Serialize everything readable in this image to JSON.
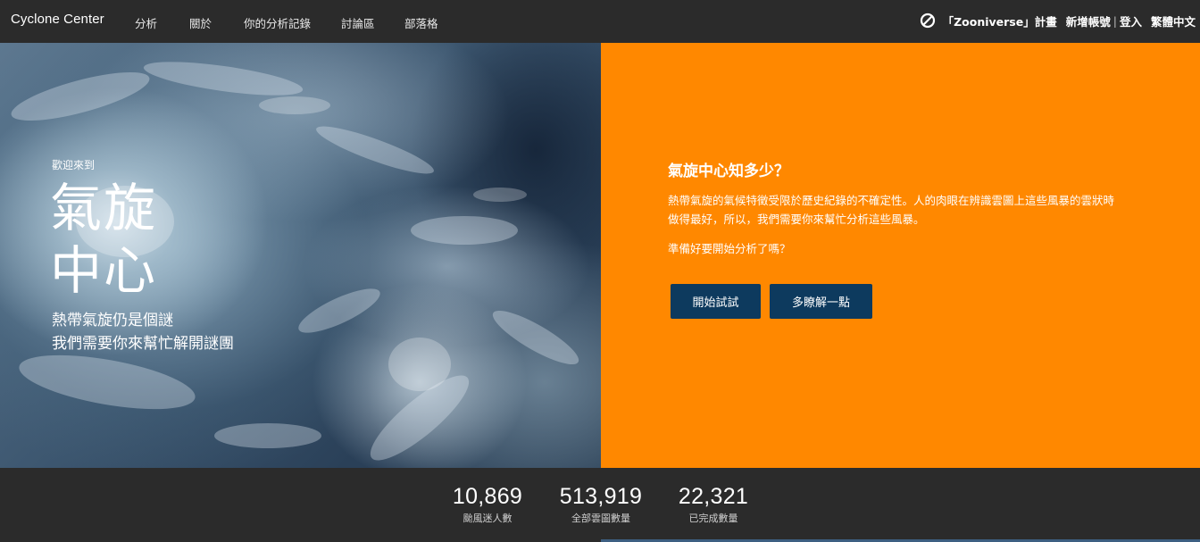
{
  "header": {
    "brand": "Cyclone Center",
    "nav": [
      "分析",
      "關於",
      "你的分析記錄",
      "討論區",
      "部落格"
    ],
    "zooniverse_label": "「Zooniverse」計畫",
    "signup": "新增帳號",
    "separator": "|",
    "login": "登入",
    "language": "繁體中文"
  },
  "hero": {
    "welcome": "歡迎來到",
    "title_line1": "氣旋",
    "title_line2": "中心",
    "tagline_line1": "熱帶氣旋仍是個謎",
    "tagline_line2": "我們需要你來幫忙解開謎團"
  },
  "panel": {
    "title": "氣旋中心知多少？",
    "description": "熱帶氣旋的氣候特徵受限於歷史紀錄的不確定性。人的肉眼在辨識雲圖上這些風暴的雲狀時做得最好，所以，我們需要你來幫忙分析這些風暴。",
    "ready": "準備好要開始分析了嗎？",
    "start_button": "開始試試",
    "more_button": "多瞭解一點"
  },
  "stats": [
    {
      "value": "10,869",
      "label": "颱風迷人數"
    },
    {
      "value": "513,919",
      "label": "全部雲圖數量"
    },
    {
      "value": "22,321",
      "label": "已完成數量"
    }
  ],
  "colors": {
    "header_bg": "#2b2b2b",
    "panel_orange": "#ff8800",
    "button_navy": "#0d3a5e"
  },
  "icons": {
    "zooniverse": "zooniverse-logo-icon"
  }
}
